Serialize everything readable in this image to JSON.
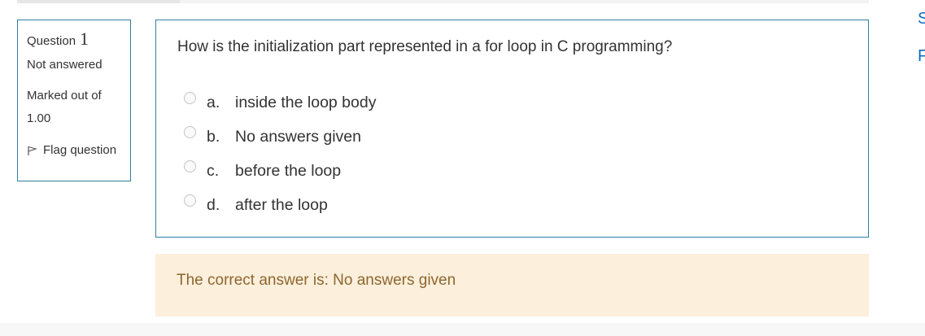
{
  "question": {
    "label": "Question",
    "number": "1",
    "state": "Not answered",
    "grade_label": "Marked out of",
    "grade_value": "1.00",
    "flag_label": "Flag question",
    "text": "How is the initialization part represented in a for loop in C programming?",
    "answers": [
      {
        "letter": "a.",
        "text": "inside the loop body"
      },
      {
        "letter": "b.",
        "text": "No answers given"
      },
      {
        "letter": "c.",
        "text": "before the loop"
      },
      {
        "letter": "d.",
        "text": "after the loop"
      }
    ]
  },
  "feedback": {
    "text": "The correct answer is: No answers given"
  },
  "side_links": [
    "S",
    "F"
  ],
  "colors": {
    "border": "#2f7fa0",
    "feedback_bg": "#fcefdc",
    "feedback_text": "#8e662e",
    "link": "#0f6cbf"
  }
}
